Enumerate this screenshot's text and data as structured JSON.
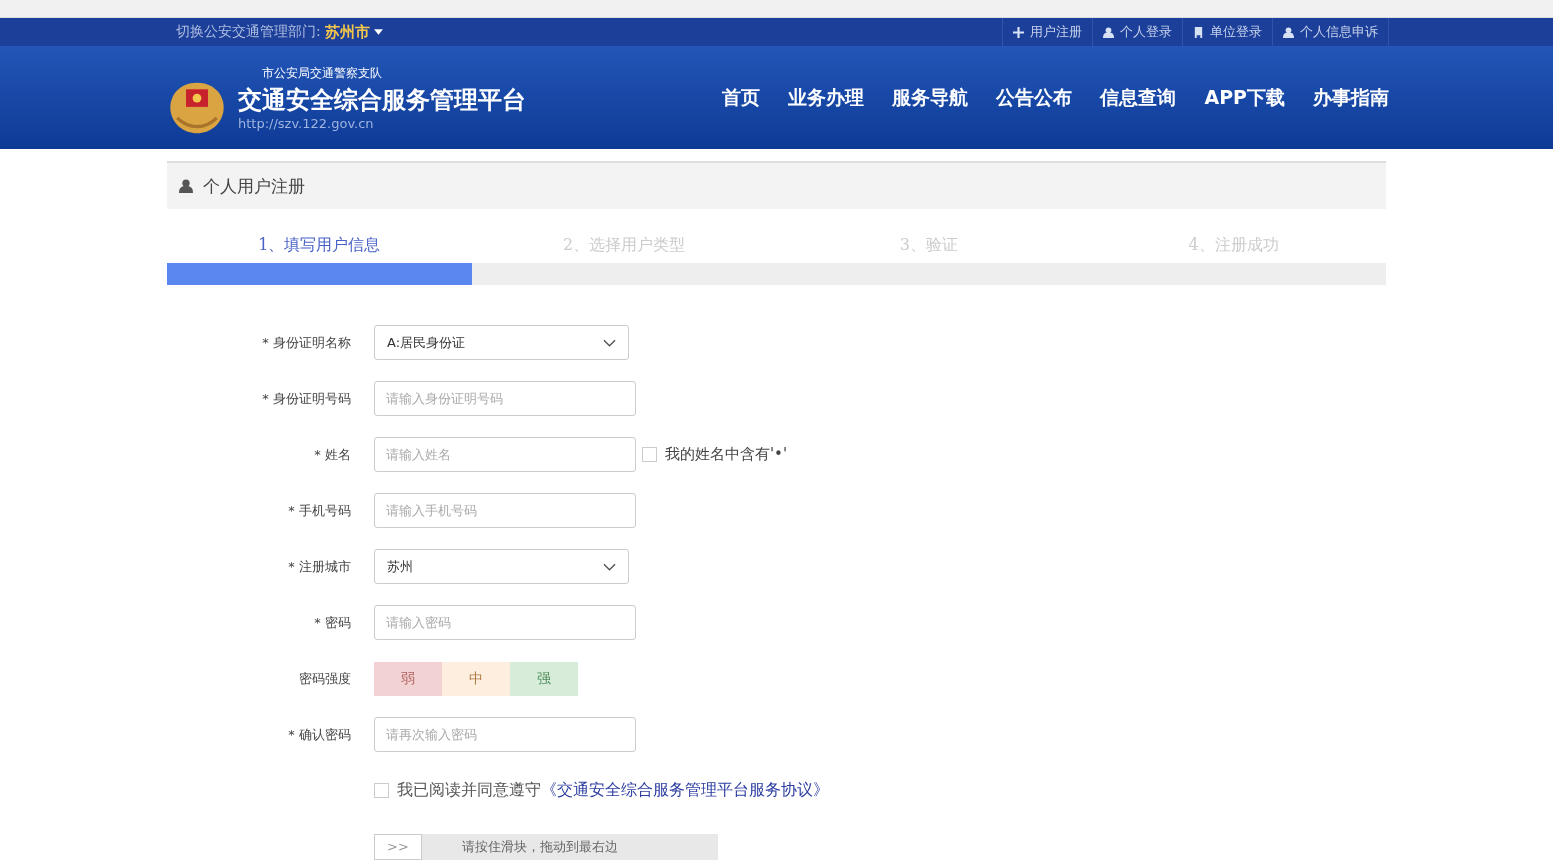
{
  "top_bar": {
    "department_label": "切换公安交通管理部门:",
    "department_value": "苏州市",
    "links": [
      {
        "kind": "plus",
        "label": "用户注册"
      },
      {
        "kind": "user",
        "label": "个人登录"
      },
      {
        "kind": "building",
        "label": "单位登录"
      },
      {
        "kind": "user",
        "label": "个人信息申诉"
      }
    ]
  },
  "header": {
    "subtitle": "市公安局交通警察支队",
    "title": "交通安全综合服务管理平台",
    "url": "http://szv.122.gov.cn",
    "nav": [
      "首页",
      "业务办理",
      "服务导航",
      "公告公布",
      "信息查询",
      "APP下载",
      "办事指南"
    ]
  },
  "panel": {
    "title": "个人用户注册"
  },
  "steps": [
    {
      "label": "1、填写用户信息",
      "selected": true
    },
    {
      "label": "2、选择用户类型",
      "selected": false
    },
    {
      "label": "3、验证",
      "selected": false
    },
    {
      "label": "4、注册成功",
      "selected": false
    }
  ],
  "progress": {
    "level": 0.25
  },
  "form": [
    {
      "kind": "select",
      "label": "* 身份证明名称",
      "value": "A:居民身份证"
    },
    {
      "kind": "input",
      "label": "* 身份证明号码",
      "placeholder": "请输入身份证明号码"
    },
    {
      "kind": "input",
      "label": "* 姓名",
      "placeholder": "请输入姓名",
      "checkbox": {
        "label": "我的姓名中含有'•'",
        "checked": false
      }
    },
    {
      "kind": "input",
      "label": "* 手机号码",
      "placeholder": "请输入手机号码"
    },
    {
      "kind": "select",
      "label": "* 注册城市",
      "value": "苏州"
    },
    {
      "kind": "input",
      "label": "* 密码",
      "placeholder": "请输入密码"
    },
    {
      "kind": "strength",
      "label": "密码强度",
      "segments": [
        {
          "label": "弱",
          "color": "#f2d2d2"
        },
        {
          "label": "中",
          "color": "#fdeedf"
        },
        {
          "label": "强",
          "color": "#d7edd9"
        }
      ]
    },
    {
      "kind": "input",
      "label": "* 确认密码",
      "placeholder": "请再次输入密码"
    }
  ],
  "agreement": {
    "checked": false,
    "text": "我已阅读并同意遵守",
    "link": "《交通安全综合服务管理平台服务协议》"
  },
  "slider": {
    "handle": ">>",
    "text": "请按住滑块，拖动到最右边"
  }
}
